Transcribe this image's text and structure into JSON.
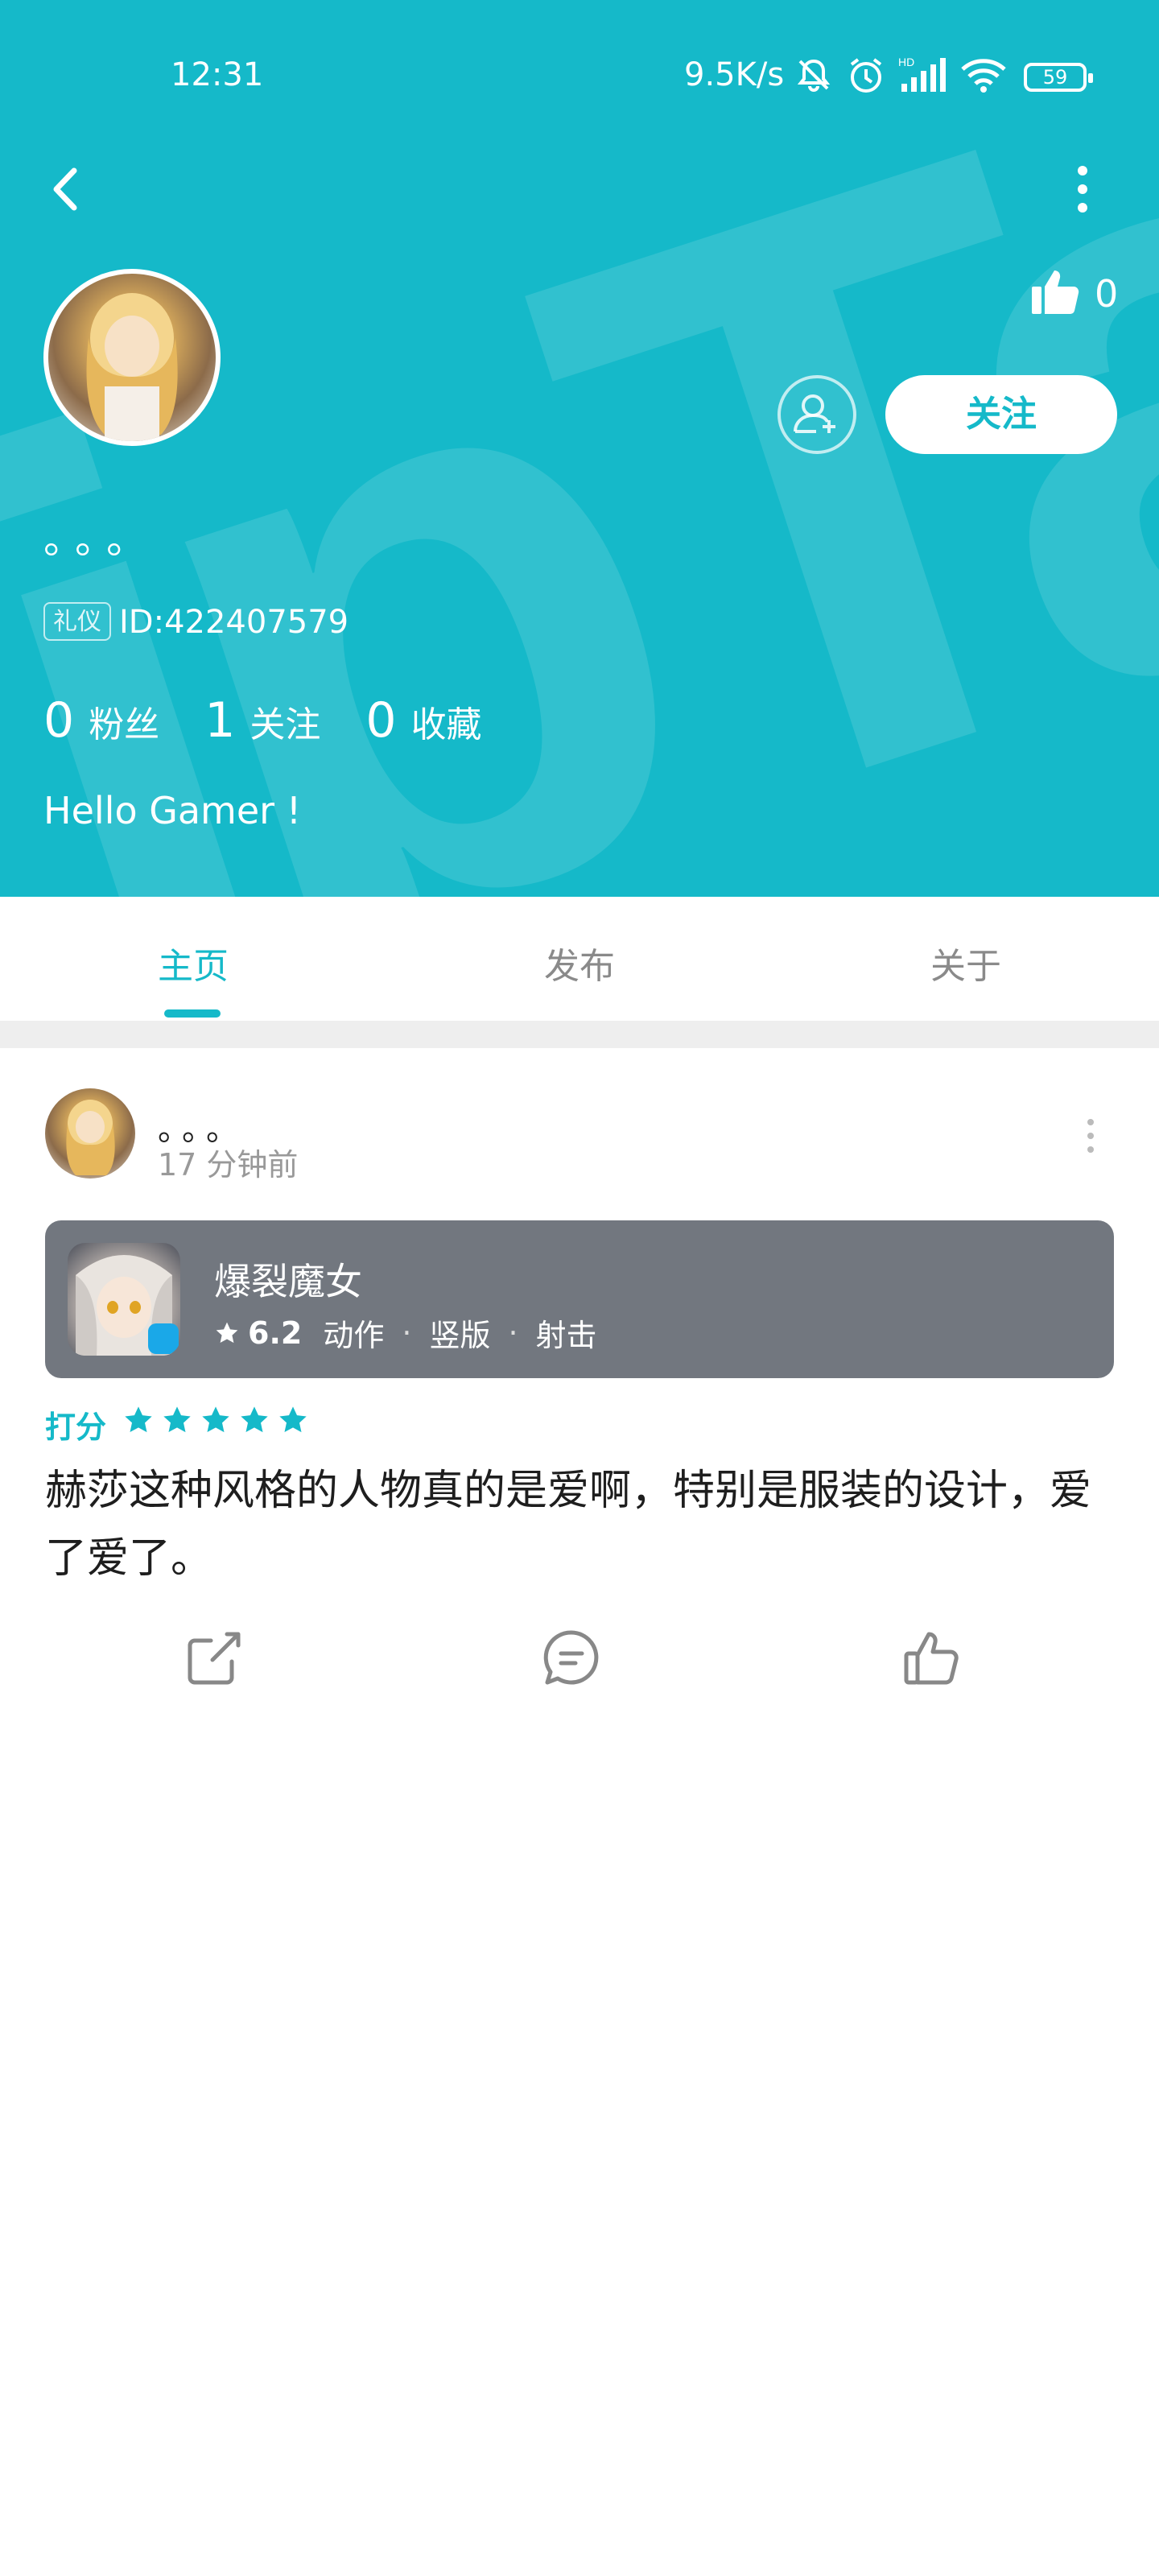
{
  "status_bar": {
    "time": "12:31",
    "net_speed": "9.5K/s",
    "battery": "59",
    "icons": [
      "bell-muted-icon",
      "alarm-icon",
      "signal-icon",
      "wifi-icon",
      "battery-icon"
    ]
  },
  "header": {
    "back_icon": "chevron-left-icon",
    "more_icon": "more-vertical-icon",
    "likes": "0",
    "follow_label": "关注",
    "username": "。。。",
    "badge": "礼仪",
    "user_id": "ID:422407579",
    "stats": [
      {
        "num": "0",
        "label": "粉丝"
      },
      {
        "num": "1",
        "label": "关注"
      },
      {
        "num": "0",
        "label": "收藏"
      }
    ],
    "bio": "Hello Gamer !"
  },
  "tabs": [
    {
      "label": "主页",
      "active": true
    },
    {
      "label": "发布",
      "active": false
    },
    {
      "label": "关于",
      "active": false
    }
  ],
  "post": {
    "author": "。。。",
    "time": "17 分钟前",
    "game": {
      "title": "爆裂魔女",
      "score": "6.2",
      "tags": [
        "动作",
        "竖版",
        "射击"
      ]
    },
    "rating_label": "打分",
    "rating_stars": 5,
    "body": "赫莎这种风格的人物真的是爱啊，特别是服装的设计，爱了爱了。"
  },
  "colors": {
    "accent": "#15b9c9",
    "game_card": "#72777f"
  }
}
